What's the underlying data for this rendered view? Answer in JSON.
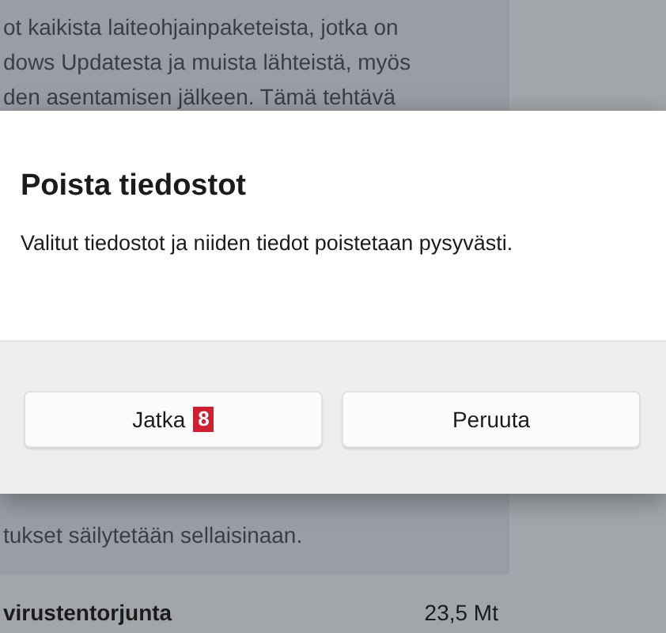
{
  "background": {
    "top_lines": [
      "ot kaikista laiteohjainpaketeista, jotka on",
      "dows Updatesta ja muista lähteistä, myös",
      "den asentamisen jälkeen. Tämä tehtävä"
    ],
    "bottom_lines": [
      "tukset säilytetään sellaisinaan."
    ],
    "row": {
      "name": "virustentorjunta",
      "size": "23,5 Mt"
    }
  },
  "dialog": {
    "title": "Poista tiedostot",
    "message": "Valitut tiedostot ja niiden tiedot poistetaan pysyvästi.",
    "buttons": [
      {
        "label": "Jatka",
        "badge": "8"
      },
      {
        "label": "Peruuta"
      }
    ]
  }
}
